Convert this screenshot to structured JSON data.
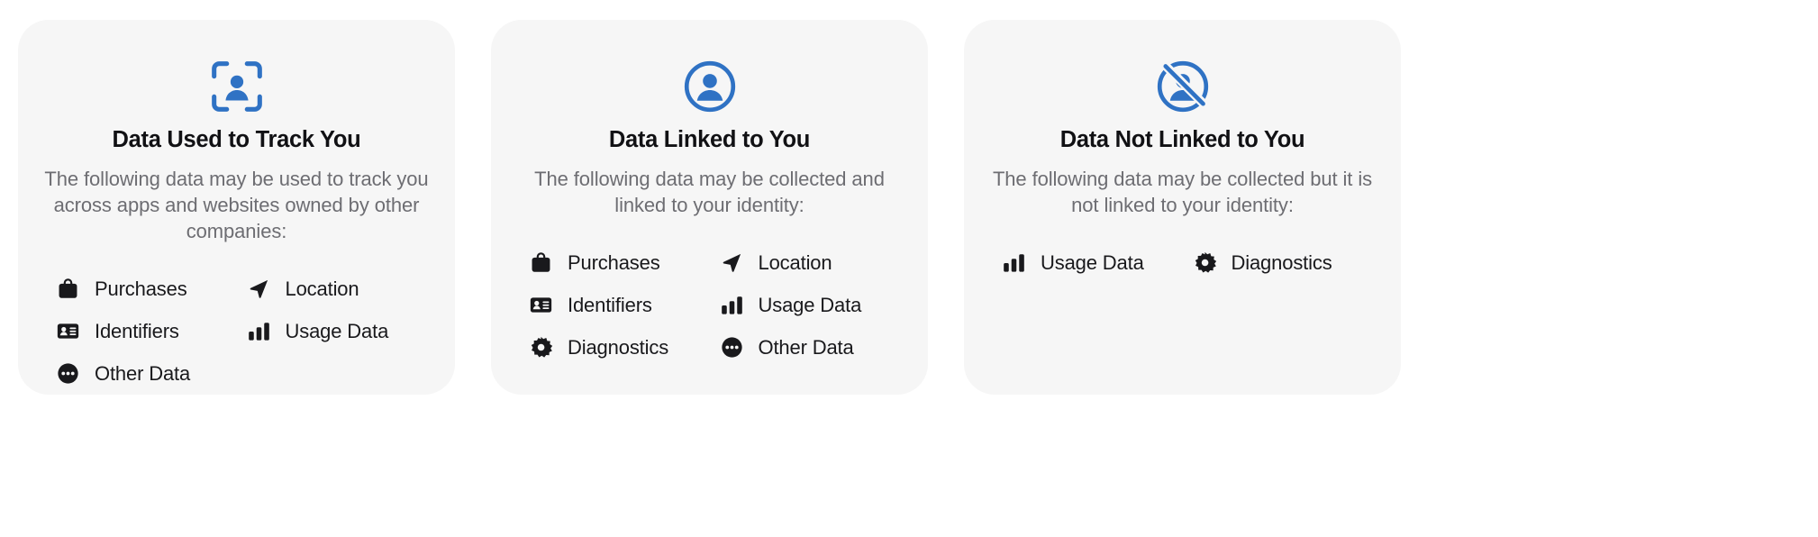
{
  "colors": {
    "card_background": "#F6F6F6",
    "page_background": "#FFFFFF",
    "hero_icon": "#2F72C4",
    "item_icon": "#19191C",
    "title_text": "#111114",
    "description_text": "#6D6D72",
    "label_text": "#19191C"
  },
  "cards": [
    {
      "hero_icon": "face-scan-icon",
      "title": "Data Used to Track You",
      "description": "The following data may be used to track you across apps and websites owned by other companies:",
      "items": [
        {
          "icon": "shopping-bag-icon",
          "label": "Purchases"
        },
        {
          "icon": "id-card-icon",
          "label": "Identifiers"
        },
        {
          "icon": "ellipsis-circle-icon",
          "label": "Other Data"
        },
        {
          "icon": "location-arrow-icon",
          "label": "Location"
        },
        {
          "icon": "bar-chart-icon",
          "label": "Usage Data"
        }
      ]
    },
    {
      "hero_icon": "person-circle-icon",
      "title": "Data Linked to You",
      "description": "The following data may be collected and linked to your identity:",
      "items": [
        {
          "icon": "shopping-bag-icon",
          "label": "Purchases"
        },
        {
          "icon": "id-card-icon",
          "label": "Identifiers"
        },
        {
          "icon": "gear-icon",
          "label": "Diagnostics"
        },
        {
          "icon": "location-arrow-icon",
          "label": "Location"
        },
        {
          "icon": "bar-chart-icon",
          "label": "Usage Data"
        },
        {
          "icon": "ellipsis-circle-icon",
          "label": "Other Data"
        }
      ]
    },
    {
      "hero_icon": "person-circle-slash-icon",
      "title": "Data Not Linked to You",
      "description": "The following data may be collected but it is not linked to your identity:",
      "items": [
        {
          "icon": "bar-chart-icon",
          "label": "Usage Data"
        },
        {
          "icon": "gear-icon",
          "label": "Diagnostics"
        }
      ]
    }
  ]
}
